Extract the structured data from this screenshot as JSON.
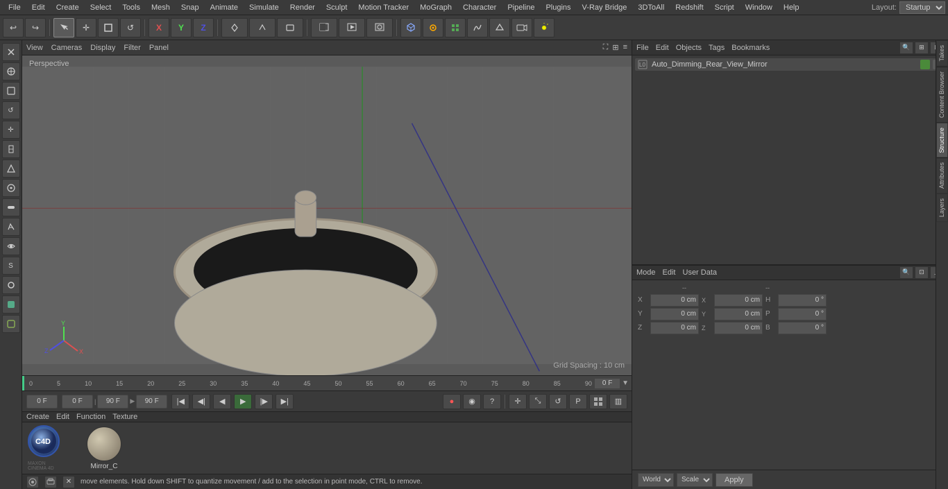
{
  "menu": {
    "items": [
      "File",
      "Edit",
      "Create",
      "Select",
      "Tools",
      "Mesh",
      "Snap",
      "Animate",
      "Simulate",
      "Render",
      "Sculpt",
      "Motion Tracker",
      "MoGraph",
      "Character",
      "Pipeline",
      "Plugins",
      "V-Ray Bridge",
      "3DToAll",
      "Redshift",
      "Script",
      "Window",
      "Help"
    ]
  },
  "layout": {
    "label": "Layout:",
    "value": "Startup"
  },
  "toolbar": {
    "undo_icon": "↩",
    "redo_icon": "↪",
    "move_icon": "✛",
    "rotate_icon": "↺",
    "scale_icon": "⤡",
    "axis_x": "X",
    "axis_y": "Y",
    "axis_z": "Z",
    "object_icon": "□",
    "camera_icon": "🎥"
  },
  "viewport": {
    "view_label": "View",
    "cameras_label": "Cameras",
    "display_label": "Display",
    "filter_label": "Filter",
    "panel_label": "Panel",
    "perspective_label": "Perspective",
    "grid_spacing": "Grid Spacing : 10 cm"
  },
  "timeline": {
    "ticks": [
      "0",
      "5",
      "10",
      "15",
      "20",
      "25",
      "30",
      "35",
      "40",
      "45",
      "50",
      "55",
      "60",
      "65",
      "70",
      "75",
      "80",
      "85",
      "90"
    ],
    "current_frame": "0 F",
    "start_frame": "0 F",
    "end_frame": "90 F",
    "preview_start": "0 F",
    "preview_end": "90 F"
  },
  "object_manager": {
    "menus": [
      "File",
      "Edit",
      "Objects",
      "Tags",
      "Bookmarks"
    ],
    "object_name": "Auto_Dimming_Rear_View_Mirror",
    "object_prefix": "L0"
  },
  "attributes": {
    "menus": [
      "Mode",
      "Edit",
      "User Data"
    ],
    "coord_labels": {
      "x_pos": "X",
      "y_pos": "Y",
      "z_pos": "Z",
      "x_rot": "X",
      "y_rot": "Y",
      "z_rot": "Z",
      "h": "H",
      "p": "P",
      "b": "B"
    },
    "coord_values": {
      "x_pos": "0 cm",
      "y_pos": "0 cm",
      "z_pos": "0 cm",
      "x_size": "0 cm",
      "y_size": "0 cm",
      "z_size": "0 cm",
      "h_val": "0 °",
      "p_val": "0 °",
      "b_val": "0 °"
    }
  },
  "bottom_controls": {
    "world_label": "World",
    "scale_label": "Scale",
    "apply_label": "Apply"
  },
  "material": {
    "menus": [
      "Create",
      "Edit",
      "Function",
      "Texture"
    ],
    "ball_name": "Mirror_C"
  },
  "status_bar": {
    "text": "move elements. Hold down SHIFT to quantize movement / add to the selection in point mode, CTRL to remove."
  },
  "right_tabs": [
    "Takes",
    "Content Browser",
    "Structure",
    "Attributes",
    "Layers"
  ],
  "playback": {
    "start_field": "0 F",
    "current_field": "0 F",
    "preview_end": "90 F",
    "end_field": "90 F"
  }
}
